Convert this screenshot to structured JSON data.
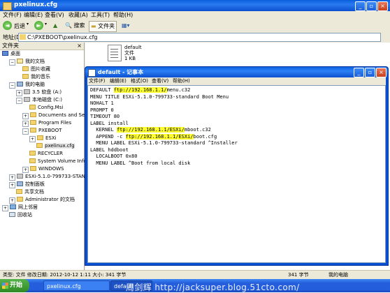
{
  "explorer": {
    "title": "pxelinux.cfg",
    "menu": [
      "文件(F)",
      "编辑(E)",
      "查看(V)",
      "收藏(A)",
      "工具(T)",
      "帮助(H)"
    ],
    "toolbar": {
      "back": "后退",
      "search": "搜索",
      "folders": "文件夹"
    },
    "address": {
      "label": "地址(D)",
      "value": "C:\\PXEBOOT\\pxelinux.cfg"
    },
    "folder_panel": {
      "title": "文件夹",
      "close": "×"
    },
    "tree": [
      "桌面",
      "我的文档",
      "图片收藏",
      "我的音乐",
      "我的电脑",
      "3.5 软盘 (A:)",
      "本地磁盘 (C:)",
      "Config.Msi",
      "Documents and Settings",
      "Program Files",
      "PXEBOOT",
      "ESXi",
      "pxelinux.cfg",
      "RECYCLER",
      "System Volume Informatio",
      "WINDOWS",
      "ESXi-5.1.0-799733-STANDARD",
      "控制面板",
      "共享文档",
      "Administrator 的文档",
      "网上邻居",
      "回收站"
    ],
    "file": {
      "name": "default",
      "type": "文件",
      "size": "1 KB"
    },
    "status": {
      "left": "类型: 文件 修改日期: 2012-10-12 1:11 大小: 341 字节",
      "size": "341 字节",
      "location": "我的电脑"
    }
  },
  "notepad": {
    "title": "default - 记事本",
    "menu": [
      "文件(F)",
      "编辑(E)",
      "格式(O)",
      "查看(V)",
      "帮助(H)"
    ],
    "lines": [
      {
        "parts": [
          [
            "DEFAULT ",
            false
          ],
          [
            "ftp://192.168.1.1/",
            true
          ],
          [
            "menu.c32",
            false
          ]
        ]
      },
      {
        "parts": [
          [
            "MENU TITLE ESXi-5.1.0-799733-standard Boot Menu",
            false
          ]
        ]
      },
      {
        "parts": [
          [
            "NOHALT 1",
            false
          ]
        ]
      },
      {
        "parts": [
          [
            "PROMPT 0",
            false
          ]
        ]
      },
      {
        "parts": [
          [
            "TIMEOUT 80",
            false
          ]
        ]
      },
      {
        "parts": [
          [
            "LABEL install",
            false
          ]
        ]
      },
      {
        "parts": [
          [
            "  KERNEL ",
            false
          ],
          [
            "ftp://192.168.1.1/ESXi/",
            true
          ],
          [
            "mboot.c32",
            false
          ]
        ]
      },
      {
        "parts": [
          [
            "  APPEND -c ",
            false
          ],
          [
            "ftp://192.168.1.1/ESXi/",
            true
          ],
          [
            "boot.cfg",
            false
          ]
        ]
      },
      {
        "parts": [
          [
            "  MENU LABEL ESXi-5.1.0-799733-standard ^Installer",
            false
          ]
        ]
      },
      {
        "parts": [
          [
            "LABEL hddboot",
            false
          ]
        ]
      },
      {
        "parts": [
          [
            "  LOCALBOOT 0x80",
            false
          ]
        ]
      },
      {
        "parts": [
          [
            "  MENU LABEL ^Boot from local disk",
            false
          ]
        ]
      }
    ]
  },
  "taskbar": {
    "start": "开始",
    "tasks": [
      "pxelinux.cfg",
      "default"
    ],
    "watermark": "周剑辉 http://jacksuper.blog.51cto.com/"
  }
}
